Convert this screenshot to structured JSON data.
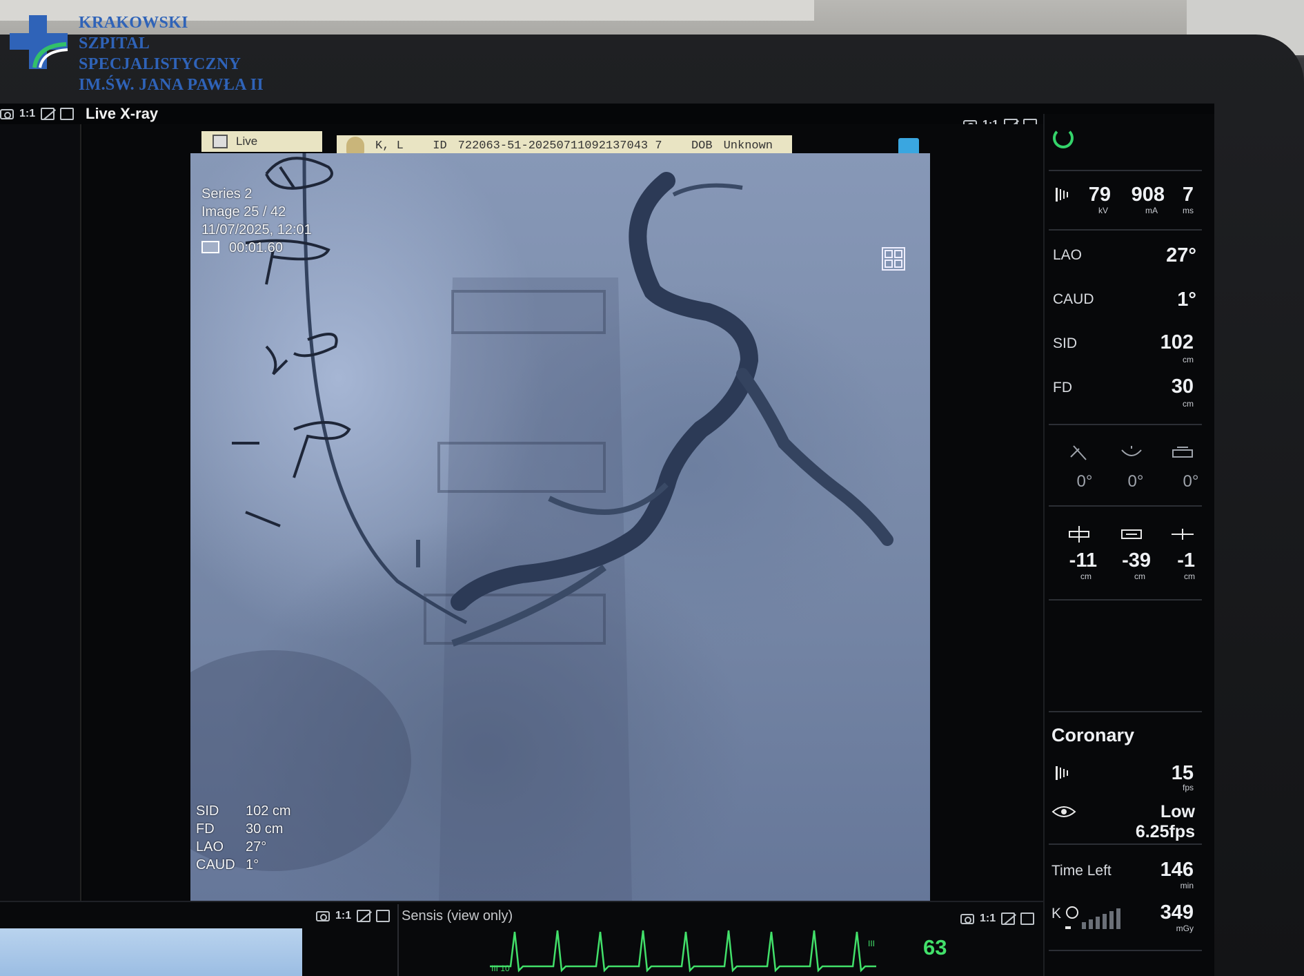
{
  "logo": {
    "line1": "KRAKOWSKI",
    "line2": "SZPITAL SPECJALISTYCZNY",
    "line3": "IM.ŚW. JANA PAWŁA II",
    "color": "#2f63b8"
  },
  "toolbar": {
    "ratio": "1:1"
  },
  "window_title": "Live X-ray",
  "tab_live": {
    "label": "Live"
  },
  "patient": {
    "name": "K, L",
    "id_label": "ID",
    "id": "722063-51-20250711092137043 7",
    "dob_label": "DOB",
    "dob": "Unknown"
  },
  "overlay": {
    "series": "Series 2",
    "image": "Image 25 / 42",
    "datetime": "11/07/2025, 12:01",
    "timer": "00:01.60",
    "sid_label": "SID",
    "sid": "102 cm",
    "fd_label": "FD",
    "fd": "30 cm",
    "lao_label": "LAO",
    "lao": "27°",
    "caud_label": "CAUD",
    "caud": "1°"
  },
  "panel": {
    "kv": "79",
    "kv_unit": "kV",
    "ma": "908",
    "ma_unit": "mA",
    "ms": "7",
    "ms_unit": "ms",
    "lao_label": "LAO",
    "lao": "27°",
    "caud_label": "CAUD",
    "caud": "1°",
    "sid_label": "SID",
    "sid": "102",
    "sid_unit": "cm",
    "fd_label": "FD",
    "fd": "30",
    "fd_unit": "cm",
    "rot1": "0°",
    "rot2": "0°",
    "rot3": "0°",
    "pos1": "-11",
    "pos2": "-39",
    "pos3": "-1",
    "pos_unit": "cm",
    "program": "Coronary",
    "fps": "15",
    "fps_unit": "fps",
    "view_mode": "Low 6.25fps",
    "time_left_label": "Time Left",
    "time_left": "146",
    "time_left_unit": "min",
    "kerma_label": "K",
    "dose": "349",
    "dose_unit": "mGy"
  },
  "bottom": {
    "sensis_label": "Sensis (view only)",
    "heart_rate": "63",
    "hr_label": "III",
    "ecg_label": "III 10"
  },
  "colors": {
    "ecg": "#42e06a",
    "accent_tab": "#e9e4c3",
    "ok": "#34d36a"
  }
}
